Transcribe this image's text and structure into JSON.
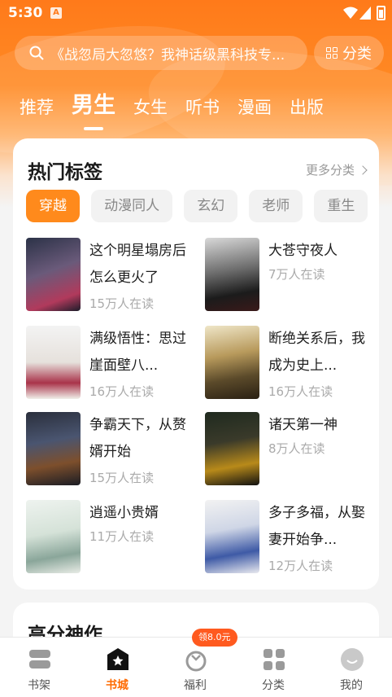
{
  "status": {
    "time": "5:30"
  },
  "search": {
    "placeholder": "《战忽局大忽悠？我神话级黑科技专...",
    "category_label": "分类"
  },
  "tabs": [
    "推荐",
    "男生",
    "女生",
    "听书",
    "漫画",
    "出版"
  ],
  "active_tab": "男生",
  "hot_tags": {
    "title": "热门标签",
    "more": "更多分类",
    "chips": [
      "穿越",
      "动漫同人",
      "玄幻",
      "老师",
      "重生"
    ]
  },
  "books": [
    {
      "title": "这个明星塌房后怎么更火了",
      "readers": "15万人在读"
    },
    {
      "title": "大苍守夜人",
      "readers": "7万人在读"
    },
    {
      "title": "满级悟性：思过崖面壁八...",
      "readers": "16万人在读"
    },
    {
      "title": "断绝关系后，我成为史上...",
      "readers": "16万人在读"
    },
    {
      "title": "争霸天下，从赘婿开始",
      "readers": "15万人在读"
    },
    {
      "title": "诸天第一神",
      "readers": "8万人在读"
    },
    {
      "title": "逍遥小贵婿",
      "readers": "11万人在读"
    },
    {
      "title": "多子多福，从娶妻开始争...",
      "readers": "12万人在读"
    }
  ],
  "section2": {
    "title": "高分神作"
  },
  "bottom_nav": {
    "items": [
      "书架",
      "书城",
      "福利",
      "分类",
      "我的"
    ],
    "badge": "领8.0元"
  },
  "colors": {
    "accent": "#ff7a1a",
    "active_nav": "#ff6a00"
  }
}
